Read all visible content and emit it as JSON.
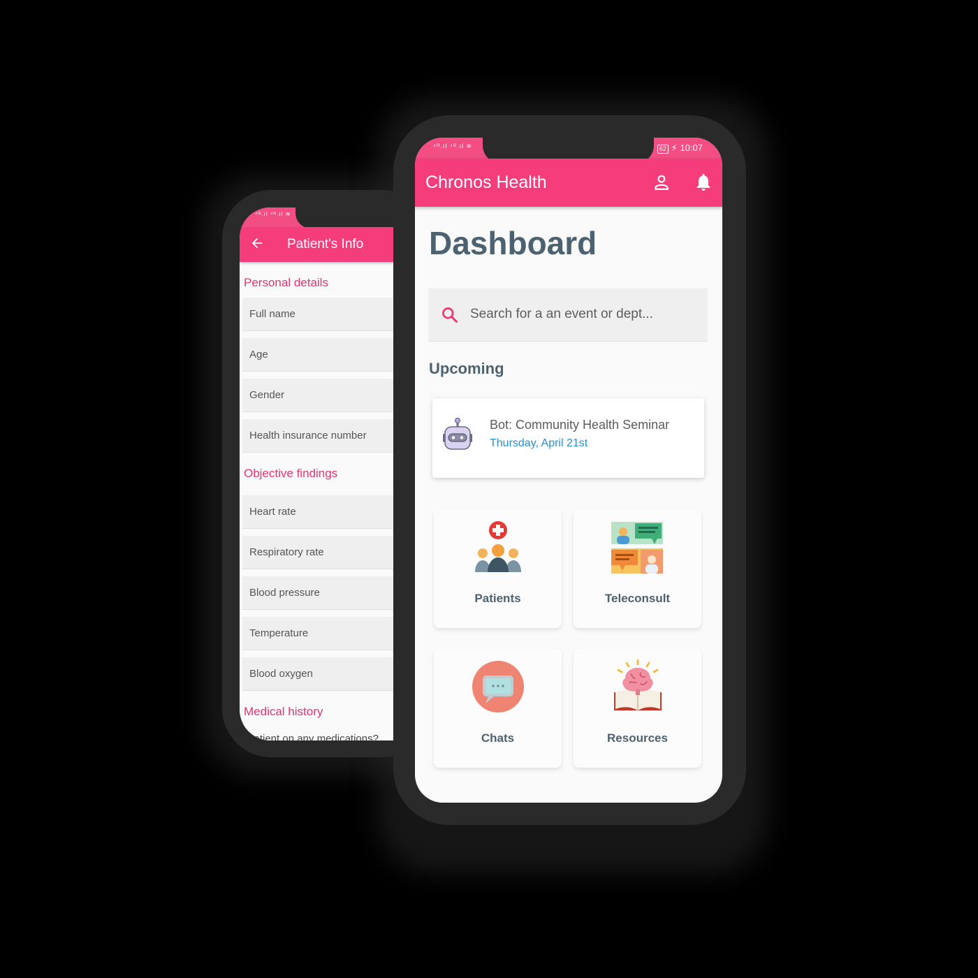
{
  "back_phone": {
    "status_icons": "⁴ᴳ.ıl ⁴ᴳ.ıl ≋",
    "title": "Patient's Info",
    "sections": [
      {
        "label": "Personal details",
        "fields": [
          "Full name",
          "Age",
          "Gender",
          "Health insurance number"
        ]
      },
      {
        "label": "Objective findings",
        "fields": [
          "Heart rate",
          "Respiratory rate",
          "Blood pressure",
          "Temperature",
          "Blood oxygen"
        ]
      },
      {
        "label": "Medical history",
        "fields": []
      }
    ],
    "cutoff_text": "...atient on any medications?"
  },
  "front_phone": {
    "status_left": "⁴ᴳ.ıl ⁴ᴳ.ıl ≋",
    "battery": "62",
    "time": "10:07",
    "app_title": "Chronos Health",
    "page_title": "Dashboard",
    "search": {
      "placeholder": "Search for a an event or dept..."
    },
    "upcoming_label": "Upcoming",
    "event": {
      "title": "Bot: Community Health Seminar",
      "date": "Thursday, April 21st"
    },
    "tiles": [
      {
        "label": "Patients",
        "icon": "patients-icon"
      },
      {
        "label": "Teleconsult",
        "icon": "teleconsult-icon"
      },
      {
        "label": "Chats",
        "icon": "chats-icon"
      },
      {
        "label": "Resources",
        "icon": "resources-icon"
      }
    ]
  },
  "colors": {
    "accent": "#f53d7b",
    "section_label": "#e8336f",
    "heading": "#4d6270",
    "date": "#2a8fc9"
  }
}
